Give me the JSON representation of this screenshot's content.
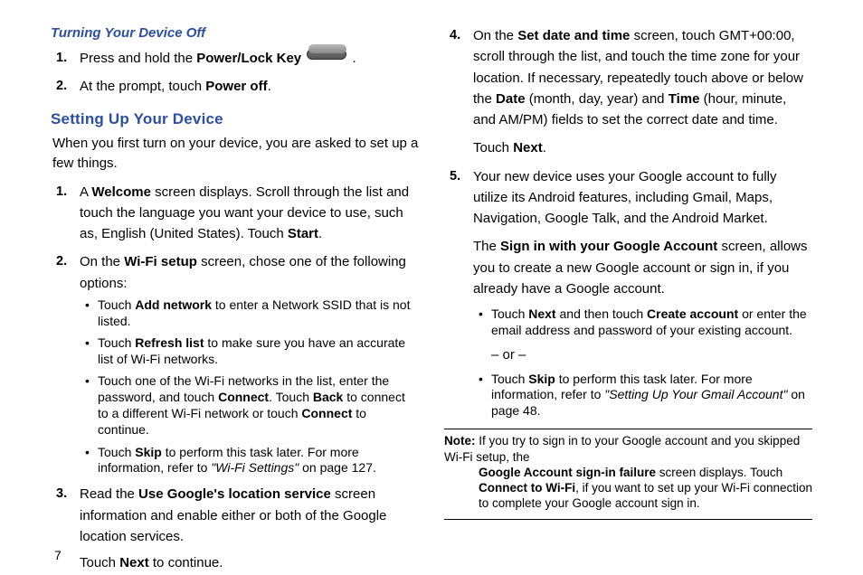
{
  "page_number": "7",
  "left": {
    "heading_turning": "Turning Your Device Off",
    "steps_turning": {
      "s1_pre": "Press and hold the ",
      "s1_bold": "Power/Lock Key",
      "s1_post": " .",
      "s2_pre": "At the prompt, touch ",
      "s2_bold": "Power off",
      "s2_post": "."
    },
    "heading_setting": "Setting Up Your Device",
    "intro": "When you first turn on your device, you are asked to set up a few things.",
    "s1": {
      "pre": "A ",
      "b1": "Welcome",
      "mid": " screen displays. Scroll through the list and touch the language you want your device to use, such as, English (United States). Touch ",
      "b2": "Start",
      "post": "."
    },
    "s2": {
      "pre": "On the ",
      "b1": "Wi-Fi setup",
      "post": " screen, chose one of the following options:",
      "b_add_pre": "Touch ",
      "b_add_b": "Add network",
      "b_add_post": " to enter a Network SSID that is not listed.",
      "b_refresh_pre": "Touch ",
      "b_refresh_b": "Refresh list",
      "b_refresh_post": " to make sure you have an accurate list of Wi-Fi networks.",
      "b_connect_pre": "Touch one of the Wi-Fi networks in the list, enter the password, and touch ",
      "b_connect_b1": "Connect",
      "b_connect_mid1": ". Touch ",
      "b_connect_b2": "Back",
      "b_connect_mid2": " to connect to a different Wi-Fi network or touch ",
      "b_connect_b3": "Connect",
      "b_connect_post": " to continue.",
      "b_skip_pre": "Touch ",
      "b_skip_b": "Skip",
      "b_skip_post": " to perform this task later. For more information, refer to ",
      "b_skip_ref": "\"Wi-Fi Settings\"",
      "b_skip_page": "  on page 127."
    },
    "s3": {
      "pre": "Read the ",
      "b1": "Use Google's location service",
      "mid": " screen information and enable either or both of the Google location services.",
      "cont_pre": "Touch ",
      "cont_b": "Next",
      "cont_post": " to continue."
    }
  },
  "right": {
    "s4": {
      "pre": "On the ",
      "b1": "Set date and time",
      "mid1": " screen, touch GMT+00:00, scroll through the list, and touch the time zone for your location. If necessary, repeatedly touch above or below the ",
      "b2": "Date",
      "mid2": " (month, day, year) and ",
      "b3": "Time",
      "post": " (hour, minute, and AM/PM) fields to set the correct date and time.",
      "cont_pre": "Touch ",
      "cont_b": "Next",
      "cont_post": "."
    },
    "s5": {
      "p1": "Your new device uses your Google account to fully utilize its Android features, including Gmail, Maps, Navigation, Google Talk, and the Android Market.",
      "p2_pre": "The ",
      "p2_b": "Sign in with your Google Account",
      "p2_post": " screen, allows you to create a new Google account or sign in, if you already have a Google account.",
      "b_next_pre": "Touch ",
      "b_next_b1": "Next",
      "b_next_mid": " and then touch ",
      "b_next_b2": "Create account",
      "b_next_post": " or enter the email address and password of your existing account.",
      "or": "– or –",
      "b_skip_pre": "Touch ",
      "b_skip_b": "Skip",
      "b_skip_post": " to perform this task later. For more information, refer to ",
      "b_skip_ref": "\"Setting Up Your Gmail Account\"",
      "b_skip_page": "  on page 48."
    },
    "note": {
      "label": "Note:",
      "pre": " If you try to sign in to your Google account and you skipped Wi-Fi setup, the ",
      "b1": "Google Account sign-in failure",
      "mid": " screen displays. Touch ",
      "b2": "Connect to Wi-Fi",
      "post": ", if you want to set up your Wi-Fi connection to complete your Google account sign in."
    }
  }
}
